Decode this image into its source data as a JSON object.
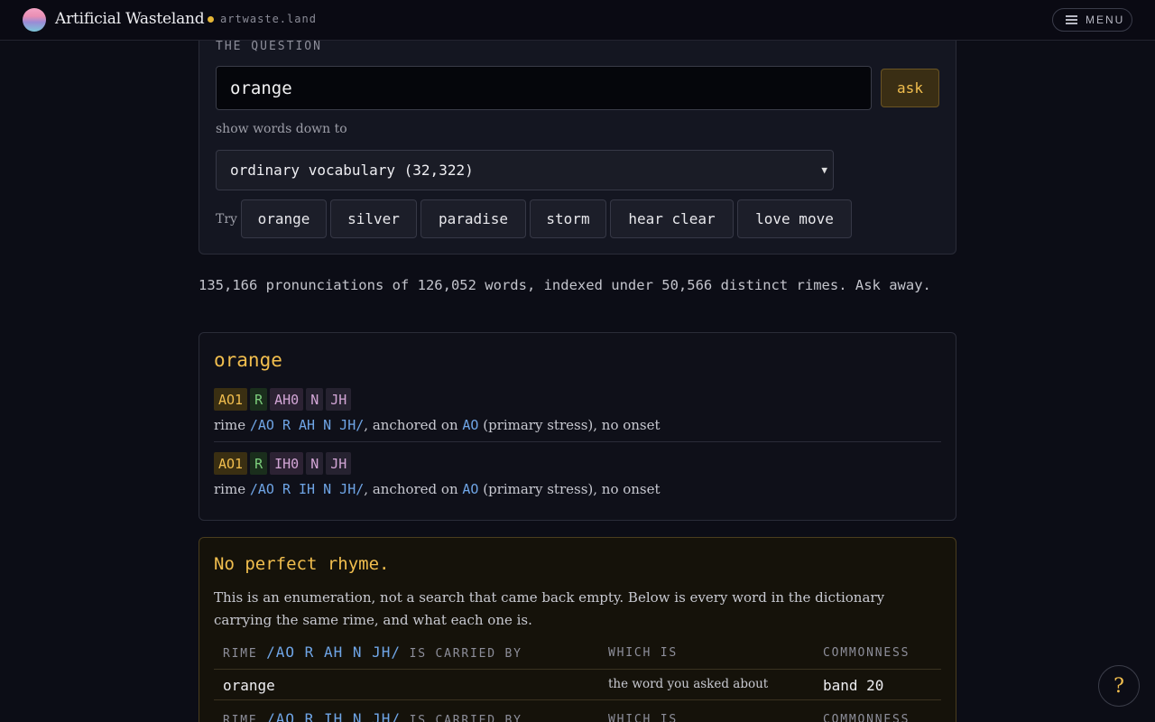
{
  "nav": {
    "brand": "Artificial Wasteland",
    "domain": "artwaste.land",
    "menu_label": "MENU",
    "status_color": "#e5b637"
  },
  "question": {
    "label": "THE QUESTION",
    "input_value": "orange",
    "ask_label": "ask",
    "show_label": "show words down to",
    "vocabulary_selected": "ordinary vocabulary (32,322)",
    "try_label": "Try",
    "try_words": [
      "orange",
      "silver",
      "paradise",
      "storm",
      "hear clear",
      "love move"
    ]
  },
  "stats_text": "135,166 pronunciations of 126,052 words, indexed under 50,566 distinct rimes. Ask away.",
  "word": {
    "title": "orange",
    "pronunciations": [
      {
        "phonemes": [
          "AO1",
          "R",
          "AH0",
          "N",
          "JH"
        ],
        "rime_prefix": "rime ",
        "rime": "/AO R AH N JH/",
        "anchor_text": ", anchored on ",
        "anchor": "AO",
        "tail": " (primary stress), no onset"
      },
      {
        "phonemes": [
          "AO1",
          "R",
          "IH0",
          "N",
          "JH"
        ],
        "rime_prefix": "rime ",
        "rime": "/AO R IH N JH/",
        "anchor_text": ", anchored on ",
        "anchor": "AO",
        "tail": " (primary stress), no onset"
      }
    ]
  },
  "no_rhyme": {
    "title": "No perfect rhyme.",
    "text": "This is an enumeration, not a search that came back empty. Below is every word in the dictionary carrying the same rime, and what each one is.",
    "table1": {
      "header_prefix": "RIME ",
      "header_rime": "/AO R AH N JH/",
      "header_suffix": " IS CARRIED BY",
      "col_which": "WHICH IS",
      "col_common": "COMMONNESS",
      "rows": [
        {
          "word": "orange",
          "which": "the word you asked about",
          "common": "band 20"
        }
      ]
    },
    "table2": {
      "header_prefix": "RIME ",
      "header_rime": "/AO R IH N JH/",
      "header_suffix": " IS CARRIED BY",
      "col_which": "WHICH IS",
      "col_common": "COMMONNESS"
    }
  },
  "help_label": "?"
}
